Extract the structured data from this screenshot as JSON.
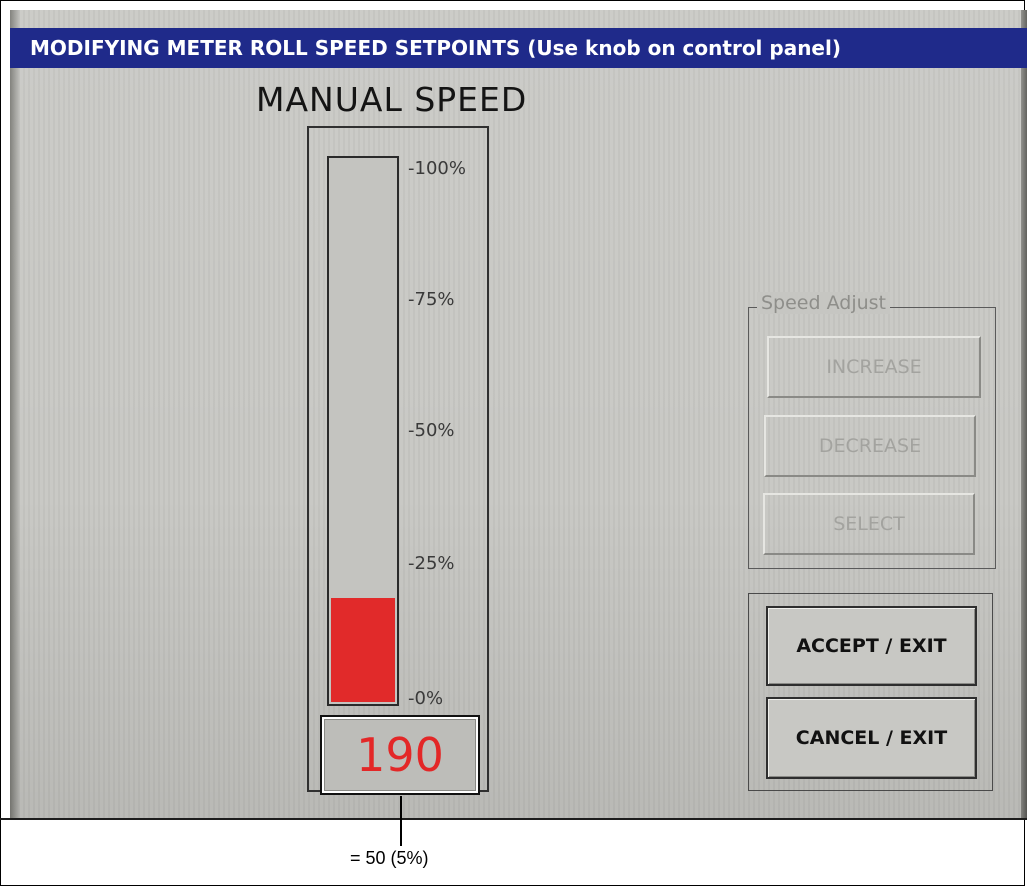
{
  "title_bar": "MODIFYING METER ROLL SPEED SETPOINTS (Use knob on control panel)",
  "heading": "MANUAL SPEED",
  "gauge": {
    "ticks": [
      "-100%",
      "-75%",
      "-50%",
      "-25%",
      "-0%"
    ],
    "fill_fraction": 0.19,
    "fill_color": "#e12a2a",
    "value": "190"
  },
  "speed_adjust": {
    "legend": "Speed Adjust",
    "increase": "INCREASE",
    "decrease": "DECREASE",
    "select": "SELECT"
  },
  "actions": {
    "accept": "ACCEPT / EXIT",
    "cancel": "CANCEL / EXIT"
  },
  "caption": "= 50 (5%)",
  "colors": {
    "title_bar": "#1f2a8a",
    "value_text": "#e32727"
  }
}
